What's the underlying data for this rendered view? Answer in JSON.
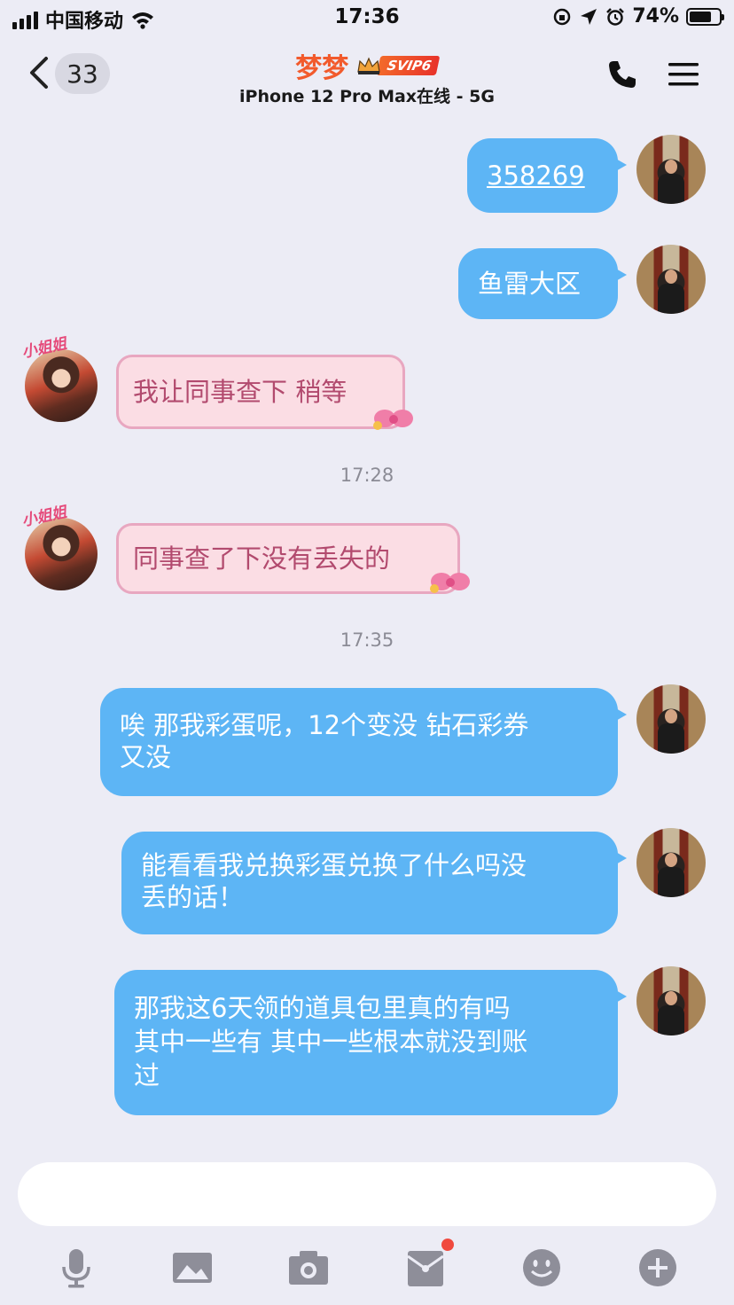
{
  "status_bar": {
    "carrier": "中国移动",
    "time": "17:36",
    "battery_percent": "74%",
    "battery_level": 0.74
  },
  "nav": {
    "back_count": "33",
    "contact_name": "梦梦",
    "vip_badge": "SVIP6",
    "subtitle": "iPhone 12 Pro Max在线 - 5G"
  },
  "her_label": "小姐姐",
  "messages": [
    {
      "sender": "me",
      "text": "358269"
    },
    {
      "sender": "me",
      "text": "鱼雷大区"
    },
    {
      "sender": "her",
      "text": "我让同事查下 稍等"
    },
    {
      "type": "time",
      "text": "17:28"
    },
    {
      "sender": "her",
      "text": "同事查了下没有丢失的"
    },
    {
      "type": "time",
      "text": "17:35"
    },
    {
      "sender": "me",
      "line1": "唉 那我彩蛋呢，12个变没 钻石彩券",
      "line2": "又没"
    },
    {
      "sender": "me",
      "line1": "能看看我兑换彩蛋兑换了什么吗没",
      "line2": "丢的话！"
    },
    {
      "sender": "me",
      "line1": "那我这6天领的道具包里真的有吗",
      "line2": "其中一些有 其中一些根本就没到账",
      "line3": "过"
    }
  ],
  "toolbar": {
    "icons": [
      "microphone-icon",
      "image-icon",
      "camera-icon",
      "red-packet-icon",
      "emoji-icon",
      "plus-icon"
    ],
    "icon_color": "#8e8e99",
    "notification_color": "#f0493e"
  },
  "colors": {
    "my_bubble": "#5db5f5",
    "her_bubble": "#fbdde4",
    "her_text": "#b24a6e",
    "name": "#f25a2c"
  }
}
